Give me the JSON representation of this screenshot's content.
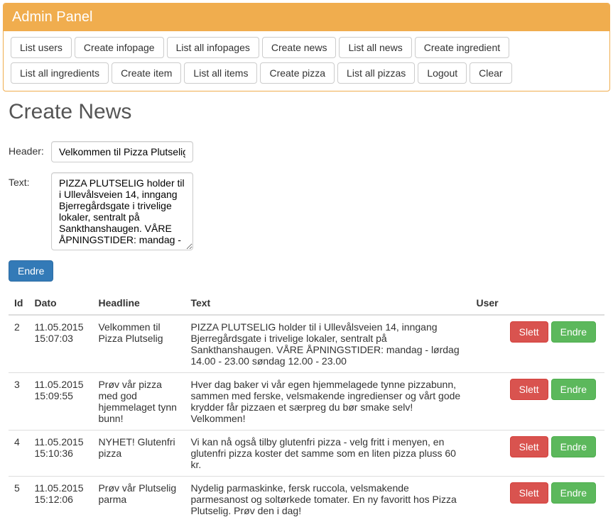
{
  "panel": {
    "title": "Admin Panel"
  },
  "nav": {
    "items": [
      "List users",
      "Create infopage",
      "List all infopages",
      "Create news",
      "List all news",
      "Create ingredient",
      "List all ingredients",
      "Create item",
      "List all items",
      "Create pizza",
      "List all pizzas",
      "Logout",
      "Clear"
    ]
  },
  "page": {
    "title": "Create News"
  },
  "form": {
    "header_label": "Header:",
    "header_value": "Velkommen til Pizza Plutselig",
    "text_label": "Text:",
    "text_value": "PIZZA PLUTSELIG holder til i Ullevålsveien 14, inngang Bjerregårdsgate i trivelige lokaler, sentralt på Sankthanshaugen. VÅRE ÅPNINGSTIDER: mandag - ",
    "submit_label": "Endre"
  },
  "table": {
    "headers": [
      "Id",
      "Dato",
      "Headline",
      "Text",
      "User"
    ],
    "rows": [
      {
        "id": "2",
        "dato": "11.05.2015 15:07:03",
        "headline": "Velkommen til Pizza Plutselig",
        "text": "PIZZA PLUTSELIG holder til i Ullevålsveien 14, inngang Bjerregårdsgate i trivelige lokaler, sentralt på Sankthanshaugen. VÅRE ÅPNINGSTIDER: mandag - lørdag 14.00 - 23.00 søndag 12.00 - 23.00",
        "user": ""
      },
      {
        "id": "3",
        "dato": "11.05.2015 15:09:55",
        "headline": "Prøv vår pizza med god hjemmelaget tynn bunn!",
        "text": "Hver dag baker vi vår egen hjemmelagede tynne pizzabunn, sammen med ferske, velsmakende ingredienser og vårt gode krydder får pizzaen et særpreg du bør smake selv! Velkommen!",
        "user": ""
      },
      {
        "id": "4",
        "dato": "11.05.2015 15:10:36",
        "headline": "NYHET! Glutenfri pizza",
        "text": "Vi kan nå også tilby glutenfri pizza - velg fritt i menyen, en glutenfri pizza koster det samme som en liten pizza pluss 60 kr.",
        "user": ""
      },
      {
        "id": "5",
        "dato": "11.05.2015 15:12:06",
        "headline": "Prøv vår Plutselig parma",
        "text": "Nydelig parmaskinke, fersk ruccola, velsmakende parmesanost og soltørkede tomater. En ny favoritt hos Pizza Plutselig. Prøv den i dag!",
        "user": ""
      }
    ],
    "row_actions": {
      "delete_label": "Slett",
      "edit_label": "Endre"
    }
  }
}
